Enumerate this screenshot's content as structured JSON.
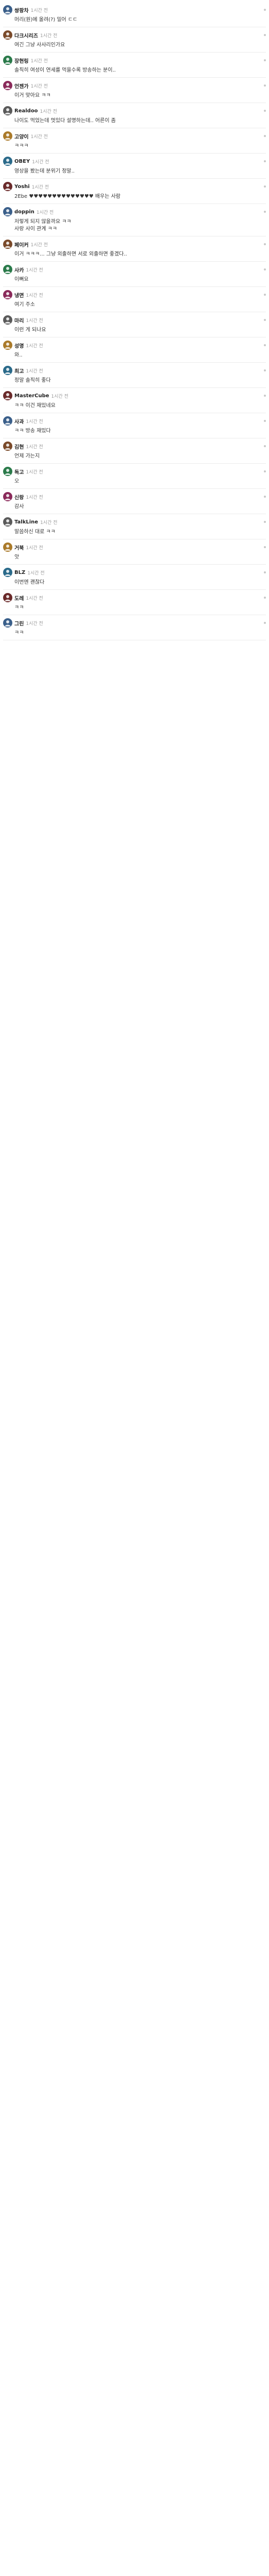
{
  "comments": [
    {
      "nick": "쌍팡차",
      "meta": "1시간 전",
      "body": "머리(원)에 올려(?) 밀어 ㄷㄷ",
      "reply": false
    },
    {
      "nick": "다크시리즈",
      "meta": "1시간 전",
      "body": "여긴 그냥 사사리인가요",
      "reply": false
    },
    {
      "nick": "장현링",
      "meta": "1시간 전",
      "body": "솔직히 여성이 연세를 먹을수록 방송하는 분이..",
      "reply": false
    },
    {
      "nick": "언젠가",
      "meta": "1시간 전",
      "body": "이거 맞아요 ㅋㅋ",
      "reply": false
    },
    {
      "nick": "Realdoo",
      "meta": "1시간 전",
      "body": "나이도 먹었는데 멋있다 설명하는데.. 어른이 좀",
      "reply": false
    },
    {
      "nick": "고양이",
      "meta": "1시간 전",
      "body": "ㅋㅋㅋ",
      "reply": false
    },
    {
      "nick": "OBEY",
      "meta": "1시간 전",
      "body": "영상을 봤는데 분위기 정말..",
      "reply": false
    },
    {
      "nick": "Yoshi",
      "meta": "1시간 전",
      "body": "2Ebe ♥♥♥♥♥♥♥♥♥♥♥♥♥♥ 배우는 사람",
      "reply": false
    },
    {
      "nick": "doppin",
      "meta": "1시간 전",
      "body": "저렇게 되지 않을까요 ㅋㅋ\n사랑 사이 관계 ㅋㅋ",
      "reply": false
    },
    {
      "nick": "페이커",
      "meta": "1시간 전",
      "body": "이거 ㅋㅋㅋ... 그냥 외출하면 서로 외출하면 좋겠다..",
      "reply": false
    },
    {
      "nick": "사카",
      "meta": "1시간 전",
      "body": "이뻐요",
      "reply": false
    },
    {
      "nick": "냉면",
      "meta": "1시간 전",
      "body": "여기 주소",
      "reply": false
    },
    {
      "nick": "마리",
      "meta": "1시간 전",
      "body": "이런 게 되나요",
      "reply": false
    },
    {
      "nick": "성명",
      "meta": "1시간 전",
      "body": "와..",
      "reply": false
    },
    {
      "nick": "최고",
      "meta": "1시간 전",
      "body": "정말 솔직히 좋다",
      "reply": false
    },
    {
      "nick": "MasterCube",
      "meta": "1시간 전",
      "body": "ㅋㅋ 이건 재밌네요",
      "reply": false
    },
    {
      "nick": "사과",
      "meta": "1시간 전",
      "body": "ㅋㅋ 방송 재밌다",
      "reply": false
    },
    {
      "nick": "김현",
      "meta": "1시간 전",
      "body": "언제 가는지",
      "reply": false
    },
    {
      "nick": "독고",
      "meta": "1시간 전",
      "body": "오",
      "reply": false
    },
    {
      "nick": "신랑",
      "meta": "1시간 전",
      "body": "감사",
      "reply": false
    },
    {
      "nick": "TalkLine",
      "meta": "1시간 전",
      "body": "말씀하신 대로 ㅋㅋ",
      "reply": false
    },
    {
      "nick": "거북",
      "meta": "1시간 전",
      "body": "앗",
      "reply": false
    },
    {
      "nick": "BLZ",
      "meta": "1시간 전",
      "body": "이번엔 괜찮다",
      "reply": false
    },
    {
      "nick": "도레",
      "meta": "1시간 전",
      "body": "ㅋㅋ",
      "reply": false
    },
    {
      "nick": "그린",
      "meta": "1시간 전",
      "body": "ㅋㅋ",
      "reply": false
    }
  ],
  "colors": {
    "nick": "#222222",
    "meta": "#9a9a9a",
    "border": "#ececec"
  }
}
